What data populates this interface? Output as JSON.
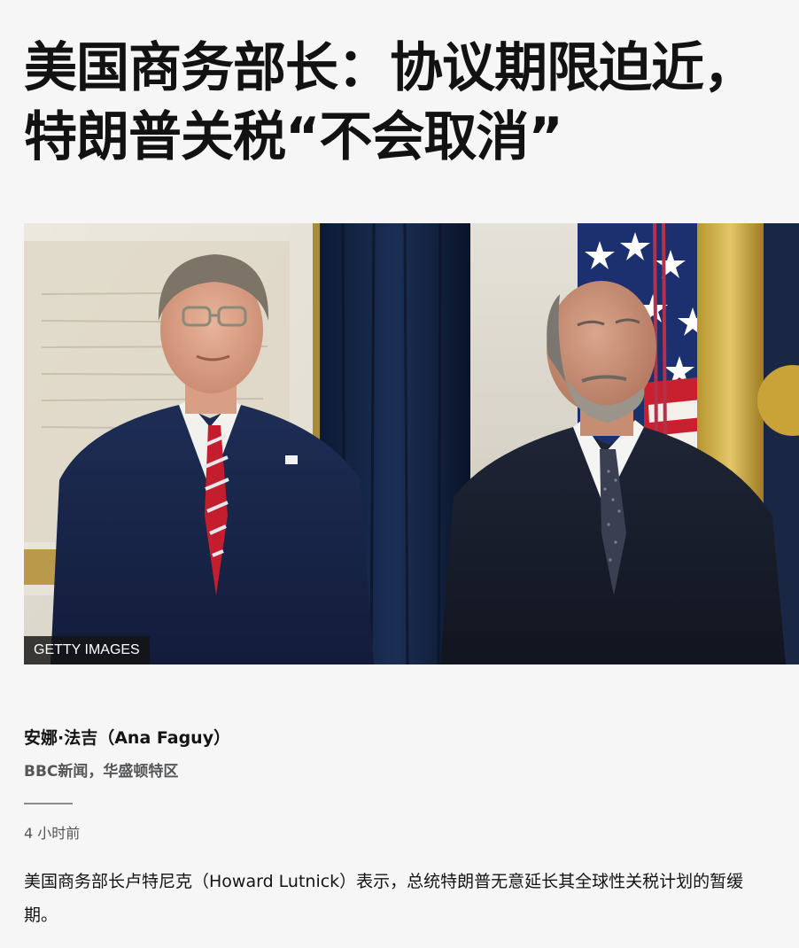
{
  "article": {
    "headline_line1": "美国商务部长：协议期限迫近，",
    "headline_line2": "特朗普关税“不会取消”",
    "image": {
      "credit": "GETTY IMAGES",
      "description_icon": "photo-two-officials"
    },
    "author": "安娜·法吉（Ana Faguy）",
    "author_role": "BBC新闻，华盛顿特区",
    "timestamp": "4 小时前",
    "lead": "美国商务部长卢特尼克（Howard Lutnick）表示，总统特朗普无意延长其全球性关税计划的暂缓期。"
  },
  "colors": {
    "background": "#f6f6f6",
    "text": "#141414",
    "secondary_text": "#545658",
    "credit_bg": "#141414"
  }
}
